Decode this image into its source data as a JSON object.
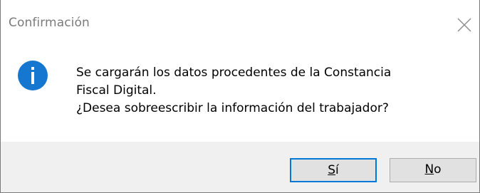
{
  "window": {
    "title": "Confirmación",
    "close_icon": "close-icon"
  },
  "message": {
    "icon": "info-icon",
    "line1": "Se cargarán los datos procedentes de la Constancia",
    "line2": "Fiscal Digital.",
    "line3": "¿Desea sobreescribir la información del trabajador?"
  },
  "buttons": {
    "yes_label": "Sí",
    "yes_mnemonic": "S",
    "no_label": "No",
    "no_mnemonic": "N"
  },
  "colors": {
    "info_icon_fill": "#1677d1",
    "default_button_border": "#0078d7",
    "footer_background": "#f0f0f0",
    "title_text": "#7b7b7b"
  }
}
